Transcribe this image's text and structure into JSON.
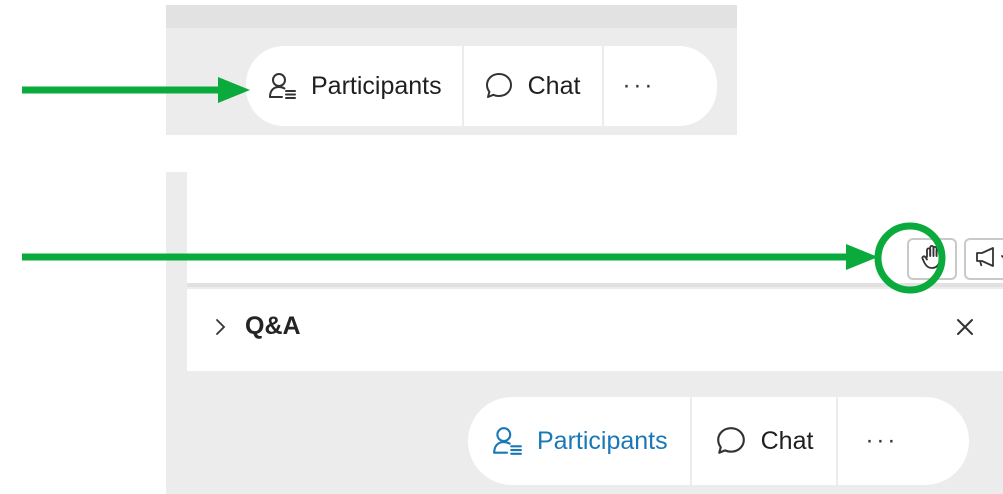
{
  "top_toolbar": {
    "participants_label": "Participants",
    "chat_label": "Chat",
    "more_label": "···"
  },
  "meeting_panel": {
    "qa_title": "Q&A",
    "qa_close_label": "×"
  },
  "bottom_toolbar": {
    "participants_label": "Participants",
    "chat_label": "Chat",
    "more_label": "···"
  },
  "colors": {
    "annotation": "#0aaa3c",
    "active_tab": "#1b78b7",
    "panel_background": "#ececec"
  },
  "icons": [
    "people-list-icon",
    "chat-bubble-icon",
    "more-icon",
    "raise-hand-icon",
    "megaphone-icon",
    "chevron-down-icon",
    "chevron-right-icon",
    "close-icon",
    "arrow-icon",
    "highlight-circle"
  ]
}
